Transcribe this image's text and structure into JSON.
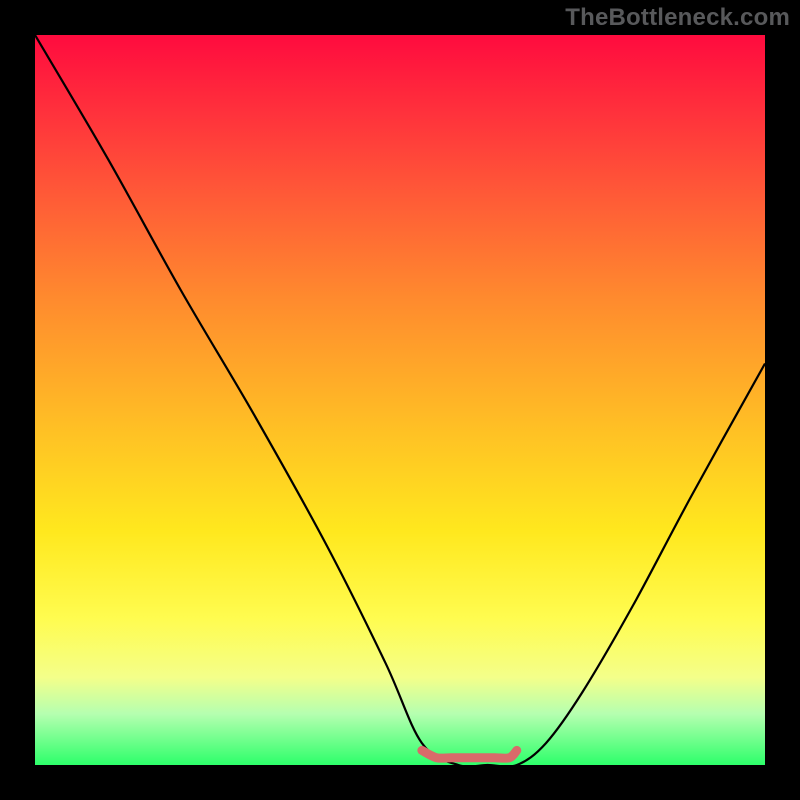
{
  "watermark": {
    "text": "TheBottleneck.com"
  },
  "chart_data": {
    "type": "line",
    "title": "",
    "xlabel": "",
    "ylabel": "",
    "xlim": [
      0,
      100
    ],
    "ylim": [
      0,
      100
    ],
    "series": [
      {
        "name": "curve",
        "x": [
          0,
          10,
          20,
          30,
          40,
          48,
          53,
          58,
          62,
          66,
          70,
          75,
          82,
          90,
          100
        ],
        "values": [
          100,
          83,
          65,
          48,
          30,
          14,
          3,
          0,
          0,
          0,
          3,
          10,
          22,
          37,
          55
        ]
      },
      {
        "name": "bottom-marker",
        "x": [
          53,
          55,
          57,
          59,
          61,
          63,
          65,
          66
        ],
        "values": [
          2,
          1,
          1,
          1,
          1,
          1,
          1,
          2
        ]
      }
    ]
  },
  "colors": {
    "curve": "#000000",
    "marker": "#d96a6a",
    "background_black": "#000000"
  }
}
